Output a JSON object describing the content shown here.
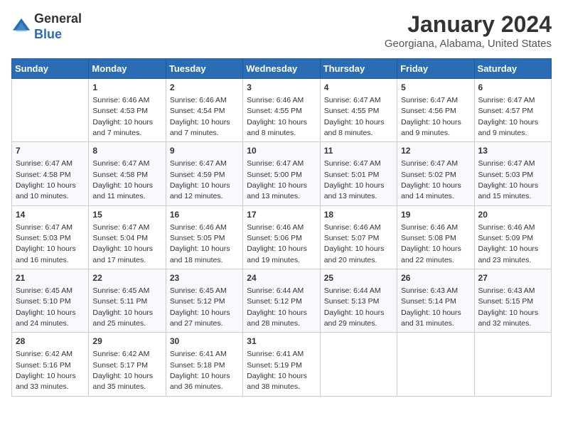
{
  "logo": {
    "general": "General",
    "blue": "Blue"
  },
  "title": "January 2024",
  "subtitle": "Georgiana, Alabama, United States",
  "headers": [
    "Sunday",
    "Monday",
    "Tuesday",
    "Wednesday",
    "Thursday",
    "Friday",
    "Saturday"
  ],
  "weeks": [
    [
      {
        "day": "",
        "info": ""
      },
      {
        "day": "1",
        "info": "Sunrise: 6:46 AM\nSunset: 4:53 PM\nDaylight: 10 hours\nand 7 minutes."
      },
      {
        "day": "2",
        "info": "Sunrise: 6:46 AM\nSunset: 4:54 PM\nDaylight: 10 hours\nand 7 minutes."
      },
      {
        "day": "3",
        "info": "Sunrise: 6:46 AM\nSunset: 4:55 PM\nDaylight: 10 hours\nand 8 minutes."
      },
      {
        "day": "4",
        "info": "Sunrise: 6:47 AM\nSunset: 4:55 PM\nDaylight: 10 hours\nand 8 minutes."
      },
      {
        "day": "5",
        "info": "Sunrise: 6:47 AM\nSunset: 4:56 PM\nDaylight: 10 hours\nand 9 minutes."
      },
      {
        "day": "6",
        "info": "Sunrise: 6:47 AM\nSunset: 4:57 PM\nDaylight: 10 hours\nand 9 minutes."
      }
    ],
    [
      {
        "day": "7",
        "info": "Sunrise: 6:47 AM\nSunset: 4:58 PM\nDaylight: 10 hours\nand 10 minutes."
      },
      {
        "day": "8",
        "info": "Sunrise: 6:47 AM\nSunset: 4:58 PM\nDaylight: 10 hours\nand 11 minutes."
      },
      {
        "day": "9",
        "info": "Sunrise: 6:47 AM\nSunset: 4:59 PM\nDaylight: 10 hours\nand 12 minutes."
      },
      {
        "day": "10",
        "info": "Sunrise: 6:47 AM\nSunset: 5:00 PM\nDaylight: 10 hours\nand 13 minutes."
      },
      {
        "day": "11",
        "info": "Sunrise: 6:47 AM\nSunset: 5:01 PM\nDaylight: 10 hours\nand 13 minutes."
      },
      {
        "day": "12",
        "info": "Sunrise: 6:47 AM\nSunset: 5:02 PM\nDaylight: 10 hours\nand 14 minutes."
      },
      {
        "day": "13",
        "info": "Sunrise: 6:47 AM\nSunset: 5:03 PM\nDaylight: 10 hours\nand 15 minutes."
      }
    ],
    [
      {
        "day": "14",
        "info": "Sunrise: 6:47 AM\nSunset: 5:03 PM\nDaylight: 10 hours\nand 16 minutes."
      },
      {
        "day": "15",
        "info": "Sunrise: 6:47 AM\nSunset: 5:04 PM\nDaylight: 10 hours\nand 17 minutes."
      },
      {
        "day": "16",
        "info": "Sunrise: 6:46 AM\nSunset: 5:05 PM\nDaylight: 10 hours\nand 18 minutes."
      },
      {
        "day": "17",
        "info": "Sunrise: 6:46 AM\nSunset: 5:06 PM\nDaylight: 10 hours\nand 19 minutes."
      },
      {
        "day": "18",
        "info": "Sunrise: 6:46 AM\nSunset: 5:07 PM\nDaylight: 10 hours\nand 20 minutes."
      },
      {
        "day": "19",
        "info": "Sunrise: 6:46 AM\nSunset: 5:08 PM\nDaylight: 10 hours\nand 22 minutes."
      },
      {
        "day": "20",
        "info": "Sunrise: 6:46 AM\nSunset: 5:09 PM\nDaylight: 10 hours\nand 23 minutes."
      }
    ],
    [
      {
        "day": "21",
        "info": "Sunrise: 6:45 AM\nSunset: 5:10 PM\nDaylight: 10 hours\nand 24 minutes."
      },
      {
        "day": "22",
        "info": "Sunrise: 6:45 AM\nSunset: 5:11 PM\nDaylight: 10 hours\nand 25 minutes."
      },
      {
        "day": "23",
        "info": "Sunrise: 6:45 AM\nSunset: 5:12 PM\nDaylight: 10 hours\nand 27 minutes."
      },
      {
        "day": "24",
        "info": "Sunrise: 6:44 AM\nSunset: 5:12 PM\nDaylight: 10 hours\nand 28 minutes."
      },
      {
        "day": "25",
        "info": "Sunrise: 6:44 AM\nSunset: 5:13 PM\nDaylight: 10 hours\nand 29 minutes."
      },
      {
        "day": "26",
        "info": "Sunrise: 6:43 AM\nSunset: 5:14 PM\nDaylight: 10 hours\nand 31 minutes."
      },
      {
        "day": "27",
        "info": "Sunrise: 6:43 AM\nSunset: 5:15 PM\nDaylight: 10 hours\nand 32 minutes."
      }
    ],
    [
      {
        "day": "28",
        "info": "Sunrise: 6:42 AM\nSunset: 5:16 PM\nDaylight: 10 hours\nand 33 minutes."
      },
      {
        "day": "29",
        "info": "Sunrise: 6:42 AM\nSunset: 5:17 PM\nDaylight: 10 hours\nand 35 minutes."
      },
      {
        "day": "30",
        "info": "Sunrise: 6:41 AM\nSunset: 5:18 PM\nDaylight: 10 hours\nand 36 minutes."
      },
      {
        "day": "31",
        "info": "Sunrise: 6:41 AM\nSunset: 5:19 PM\nDaylight: 10 hours\nand 38 minutes."
      },
      {
        "day": "",
        "info": ""
      },
      {
        "day": "",
        "info": ""
      },
      {
        "day": "",
        "info": ""
      }
    ]
  ]
}
